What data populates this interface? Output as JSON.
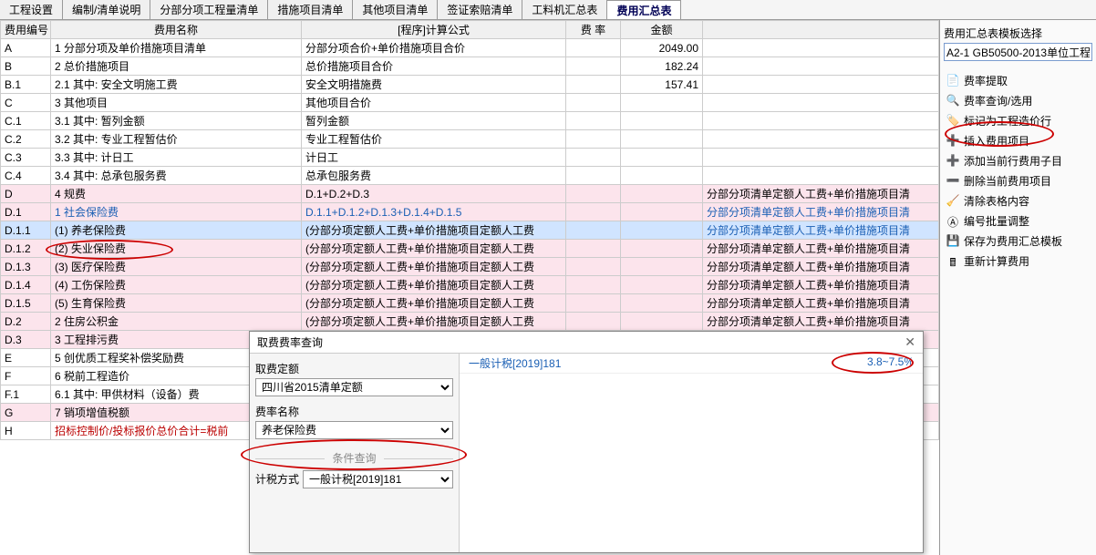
{
  "tabs": [
    "工程设置",
    "编制/清单说明",
    "分部分项工程量清单",
    "措施项目清单",
    "其他项目清单",
    "签证索赔清单",
    "工料机汇总表",
    "费用汇总表"
  ],
  "activeTab": 7,
  "columns": {
    "code": "费用编号",
    "name": "费用名称",
    "formula": "[程序]计算公式",
    "rate": "费 率",
    "amount": "金额"
  },
  "rows": [
    {
      "code": "A",
      "name": "1 分部分项及单价措施项目清单",
      "formula": "分部分项合价+单价措施项目合价",
      "amount": "2049.00",
      "note": ""
    },
    {
      "code": "B",
      "name": "2 总价措施项目",
      "formula": "总价措施项目合价",
      "amount": "182.24",
      "note": ""
    },
    {
      "code": "B.1",
      "name": "2.1 其中: 安全文明施工费",
      "formula": "安全文明措施费",
      "amount": "157.41",
      "note": ""
    },
    {
      "code": "C",
      "name": "3 其他项目",
      "formula": "其他项目合价",
      "amount": "",
      "note": ""
    },
    {
      "code": "C.1",
      "name": "3.1 其中: 暂列金额",
      "formula": "暂列金额",
      "amount": "",
      "note": ""
    },
    {
      "code": "C.2",
      "name": "3.2 其中: 专业工程暂估价",
      "formula": "专业工程暂估价",
      "amount": "",
      "note": ""
    },
    {
      "code": "C.3",
      "name": "3.3 其中: 计日工",
      "formula": "计日工",
      "amount": "",
      "note": ""
    },
    {
      "code": "C.4",
      "name": "3.4 其中: 总承包服务费",
      "formula": "总承包服务费",
      "amount": "",
      "note": ""
    },
    {
      "code": "D",
      "name": "4 规费",
      "formula": "D.1+D.2+D.3",
      "amount": "",
      "note": "分部分项清单定额人工费+单价措施项目清",
      "pink": true
    },
    {
      "code": "D.1",
      "name": "1 社会保险费",
      "formula": "D.1.1+D.1.2+D.1.3+D.1.4+D.1.5",
      "amount": "",
      "note": "分部分项清单定额人工费+单价措施项目清",
      "pink": true,
      "link": true
    },
    {
      "code": "D.1.1",
      "name": "(1) 养老保险费",
      "formula": "(分部分项定额人工费+单价措施项目定额人工费",
      "amount": "",
      "note": "分部分项清单定额人工费+单价措施项目清",
      "pink": true,
      "sel": true
    },
    {
      "code": "D.1.2",
      "name": "(2) 失业保险费",
      "formula": "(分部分项定额人工费+单价措施项目定额人工费",
      "amount": "",
      "note": "分部分项清单定额人工费+单价措施项目清",
      "pink": true
    },
    {
      "code": "D.1.3",
      "name": "(3) 医疗保险费",
      "formula": "(分部分项定额人工费+单价措施项目定额人工费",
      "amount": "",
      "note": "分部分项清单定额人工费+单价措施项目清",
      "pink": true
    },
    {
      "code": "D.1.4",
      "name": "(4) 工伤保险费",
      "formula": "(分部分项定额人工费+单价措施项目定额人工费",
      "amount": "",
      "note": "分部分项清单定额人工费+单价措施项目清",
      "pink": true
    },
    {
      "code": "D.1.5",
      "name": "(5) 生育保险费",
      "formula": "(分部分项定额人工费+单价措施项目定额人工费",
      "amount": "",
      "note": "分部分项清单定额人工费+单价措施项目清",
      "pink": true
    },
    {
      "code": "D.2",
      "name": "2 住房公积金",
      "formula": "(分部分项定额人工费+单价措施项目定额人工费",
      "amount": "",
      "note": "分部分项清单定额人工费+单价措施项目清",
      "pink": true
    },
    {
      "code": "D.3",
      "name": "3 工程排污费",
      "formula": "",
      "amount": "",
      "note": "",
      "pink": true
    },
    {
      "code": "E",
      "name": "5 创优质工程奖补偿奖励费",
      "formula": "",
      "amount": "",
      "note": ""
    },
    {
      "code": "F",
      "name": "6 税前工程造价",
      "formula": "",
      "amount": "",
      "note": ""
    },
    {
      "code": "F.1",
      "name": "6.1 其中: 甲供材料（设备）费",
      "formula": "",
      "amount": "",
      "note": ""
    },
    {
      "code": "G",
      "name": "7 销项增值税额",
      "formula": "",
      "amount": "",
      "note": "",
      "pink": true
    },
    {
      "code": "H",
      "name": "招标控制价/投标报价总价合计=税前",
      "formula": "",
      "amount": "",
      "note": "",
      "red": true
    }
  ],
  "sidebar": {
    "title": "费用汇总表模板选择",
    "combo": "A2-1 GB50500-2013单位工程",
    "items": [
      {
        "icon": "📄",
        "label": "费率提取"
      },
      {
        "icon": "🔍",
        "label": "费率查询/选用",
        "hl": true
      },
      {
        "icon": "🏷️",
        "label": "标记为工程造价行"
      },
      {
        "icon": "➕",
        "label": "插入费用项目"
      },
      {
        "icon": "➕",
        "label": "添加当前行费用子目"
      },
      {
        "icon": "➖",
        "label": "删除当前费用项目"
      },
      {
        "icon": "🧹",
        "label": "清除表格内容"
      },
      {
        "icon": "Ⓐ",
        "label": "编号批量调整"
      },
      {
        "icon": "💾",
        "label": "保存为费用汇总模板"
      },
      {
        "icon": "🖩",
        "label": "重新计算费用"
      }
    ]
  },
  "dialog": {
    "title": "取费费率查询",
    "f1_label": "取费定额",
    "f1_value": "四川省2015清单定额",
    "f2_label": "费率名称",
    "f2_value": "养老保险费",
    "sep": "条件查询",
    "f3_label": "计税方式",
    "f3_value": "一般计税[2019]181",
    "result_name": "一般计税[2019]181",
    "result_rate": "3.8~7.5%"
  }
}
